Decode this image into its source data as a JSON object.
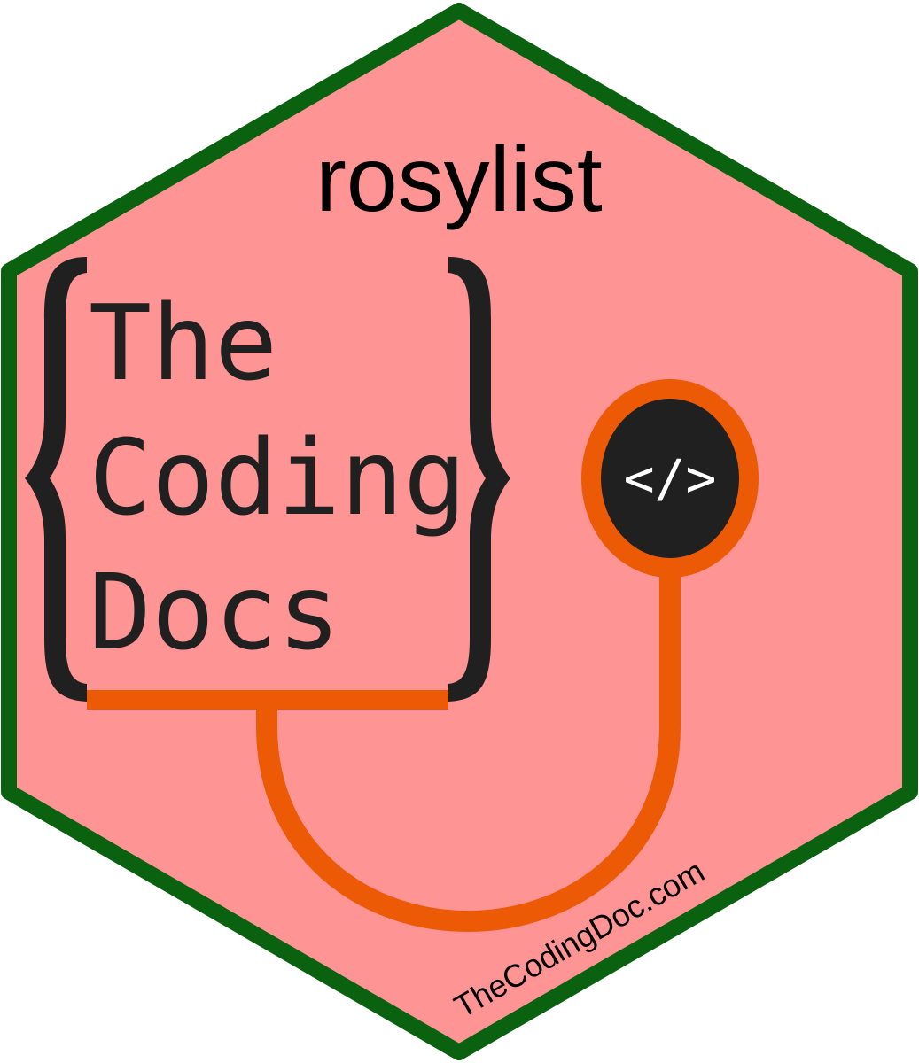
{
  "sticker": {
    "package_name": "rosylist",
    "logo": {
      "line1": "The",
      "line2": "Coding",
      "line3": "Docs",
      "code_symbol": "</>"
    },
    "url": "TheCodingDoc.com"
  },
  "colors": {
    "hex_fill": "#ff9494",
    "hex_border": "#0a610f",
    "brace": "#202020",
    "stethoscope": "#ec5a06",
    "chestpiece": "#202020"
  }
}
